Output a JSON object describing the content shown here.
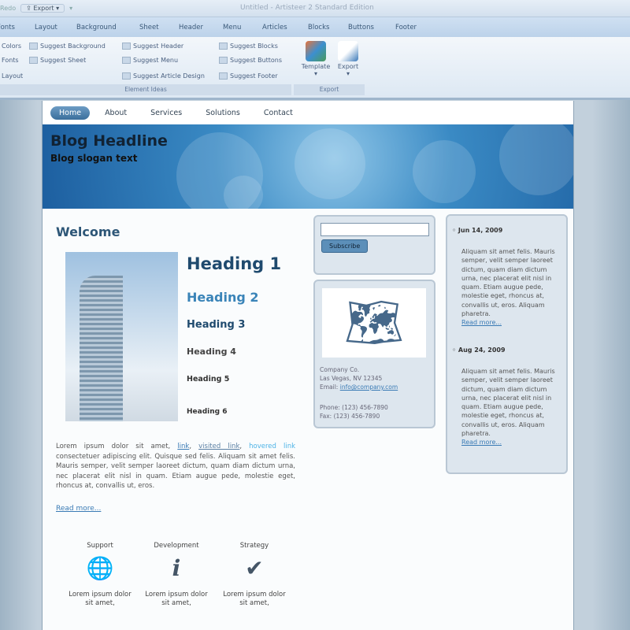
{
  "app": {
    "qat_left": "Redo",
    "qat_export": "Export",
    "title": "Untitled - Artisteer 2 Standard Edition"
  },
  "tabs": [
    "Fonts",
    "Layout",
    "Background",
    "Sheet",
    "Header",
    "Menu",
    "Articles",
    "Blocks",
    "Buttons",
    "Footer"
  ],
  "ribbon": {
    "col1": [
      "Colors",
      "Fonts",
      "Layout"
    ],
    "col2": [
      "Suggest Background",
      "Suggest Sheet"
    ],
    "col3": [
      "Suggest Header",
      "Suggest Menu",
      "Suggest Article Design"
    ],
    "col4": [
      "Suggest Blocks",
      "Suggest Buttons",
      "Suggest Footer"
    ],
    "group1": "Element Ideas",
    "template": "Template",
    "export": "Export",
    "group2": "Export"
  },
  "nav": [
    "Home",
    "About",
    "Services",
    "Solutions",
    "Contact"
  ],
  "header": {
    "headline": "Blog Headline",
    "slogan": "Blog slogan text"
  },
  "main": {
    "welcome": "Welcome",
    "headings": [
      "Heading 1",
      "Heading 2",
      "Heading 3",
      "Heading 4",
      "Heading 5",
      "Heading 6"
    ],
    "lorem_start": "Lorem ipsum dolor sit amet, ",
    "link": "link",
    "visited": "visited link",
    "hovered": "hovered link",
    "lorem_rest": " consectetuer adipiscing elit. Quisque sed felis. Aliquam sit amet felis. Mauris semper, velit semper laoreet dictum, quam diam dictum urna, nec placerat elit nisl in quam. Etiam augue pede, molestie eget, rhoncus at, convallis ut, eros.",
    "read_more": "Read more...",
    "features": [
      {
        "title": "Support",
        "text": "Lorem ipsum dolor sit amet,"
      },
      {
        "title": "Development",
        "text": "Lorem ipsum dolor sit amet,"
      },
      {
        "title": "Strategy",
        "text": "Lorem ipsum dolor sit amet,"
      }
    ]
  },
  "sidebar": {
    "subscribe": "Subscribe",
    "company": "Company Co.",
    "city": "Las Vegas, NV 12345",
    "email_label": "Email: ",
    "email": "info@company.com",
    "phone": "Phone: (123) 456-7890",
    "fax": "Fax: (123) 456-7890"
  },
  "news": [
    {
      "date": "Jun 14, 2009",
      "text": "Aliquam sit amet felis. Mauris semper, velit semper laoreet dictum, quam diam dictum urna, nec placerat elit nisl in quam. Etiam augue pede, molestie eget, rhoncus at, convallis ut, eros. Aliquam pharetra.",
      "more": "Read more..."
    },
    {
      "date": "Aug 24, 2009",
      "text": "Aliquam sit amet felis. Mauris semper, velit semper laoreet dictum, quam diam dictum urna, nec placerat elit nisl in quam. Etiam augue pede, molestie eget, rhoncus at, convallis ut, eros. Aliquam pharetra.",
      "more": "Read more..."
    }
  ]
}
